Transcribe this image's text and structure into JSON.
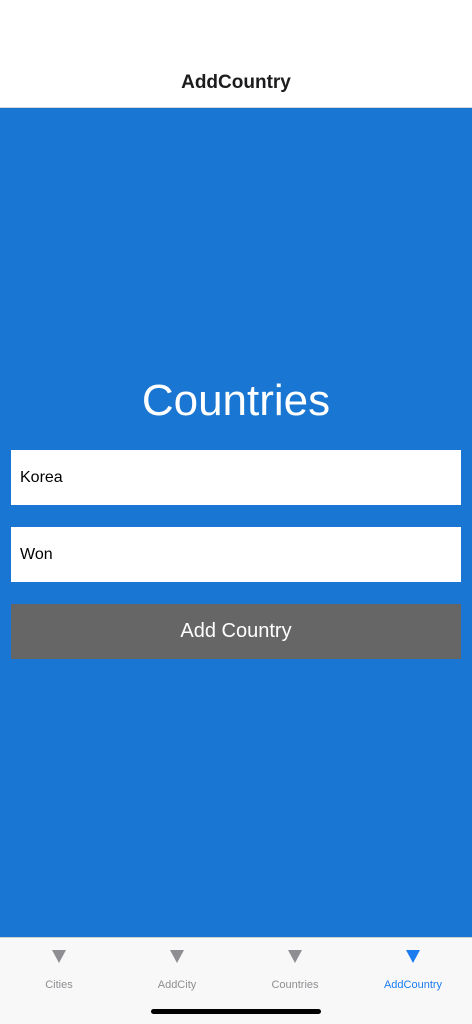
{
  "header": {
    "title": "AddCountry"
  },
  "main": {
    "heading": "Countries",
    "country_field": {
      "value": "Korea",
      "placeholder": ""
    },
    "currency_field": {
      "value": "Won",
      "placeholder": ""
    },
    "add_button_label": "Add Country"
  },
  "tabs": [
    {
      "label": "Cities",
      "icon": "triangle-down-icon",
      "active": false
    },
    {
      "label": "AddCity",
      "icon": "triangle-down-icon",
      "active": false
    },
    {
      "label": "Countries",
      "icon": "triangle-down-icon",
      "active": false
    },
    {
      "label": "AddCountry",
      "icon": "triangle-down-icon",
      "active": true
    }
  ],
  "colors": {
    "content_background": "#1976d2",
    "button_background": "#666666",
    "tab_active": "#1a7cf0",
    "tab_inactive": "#8e8e93"
  }
}
